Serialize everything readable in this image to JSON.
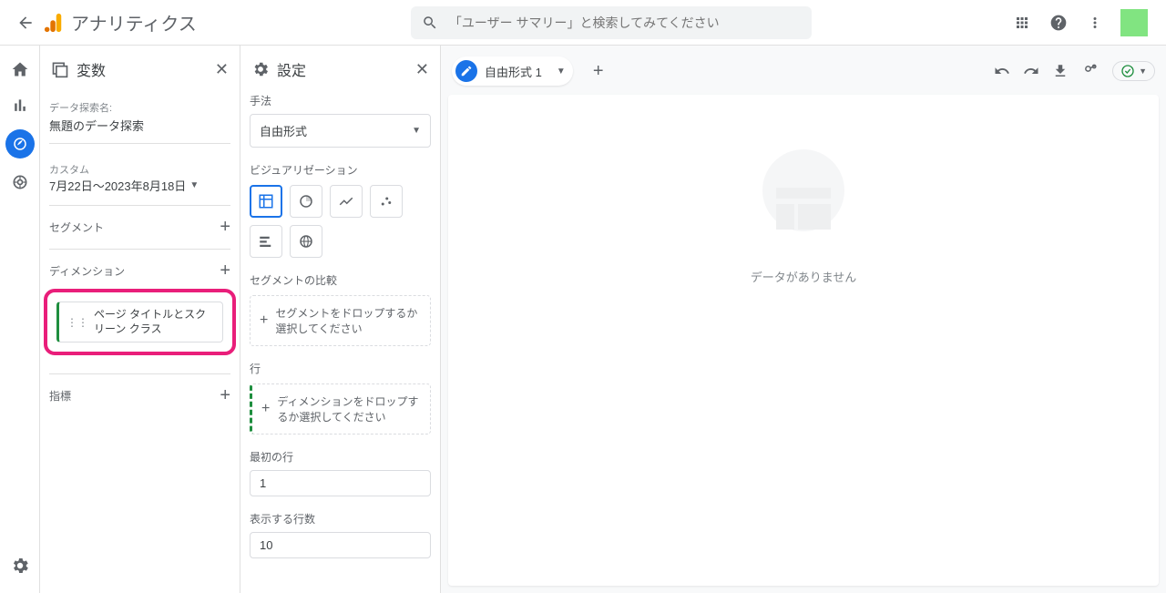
{
  "header": {
    "app_title": "アナリティクス",
    "search_placeholder": "「ユーザー サマリー」と検索してみてください"
  },
  "variables_panel": {
    "title": "変数",
    "exploration_name_label": "データ探索名:",
    "exploration_name_value": "無題のデータ探索",
    "date_label": "カスタム",
    "date_value": "7月22日～2023年8月18日",
    "segments_title": "セグメント",
    "dimensions_title": "ディメンション",
    "dimension_chip": "ページ タイトルとスクリーン クラス",
    "metrics_title": "指標"
  },
  "settings_panel": {
    "title": "設定",
    "technique_label": "手法",
    "technique_value": "自由形式",
    "visualization_label": "ビジュアリゼーション",
    "segment_compare_label": "セグメントの比較",
    "segment_drop_text": "セグメントをドロップするか選択してください",
    "rows_label": "行",
    "rows_drop_text": "ディメンションをドロップするか選択してください",
    "first_row_label": "最初の行",
    "first_row_value": "1",
    "rows_shown_label": "表示する行数",
    "rows_shown_value": "10"
  },
  "canvas": {
    "tab_label": "自由形式 1",
    "empty_text": "データがありません"
  }
}
